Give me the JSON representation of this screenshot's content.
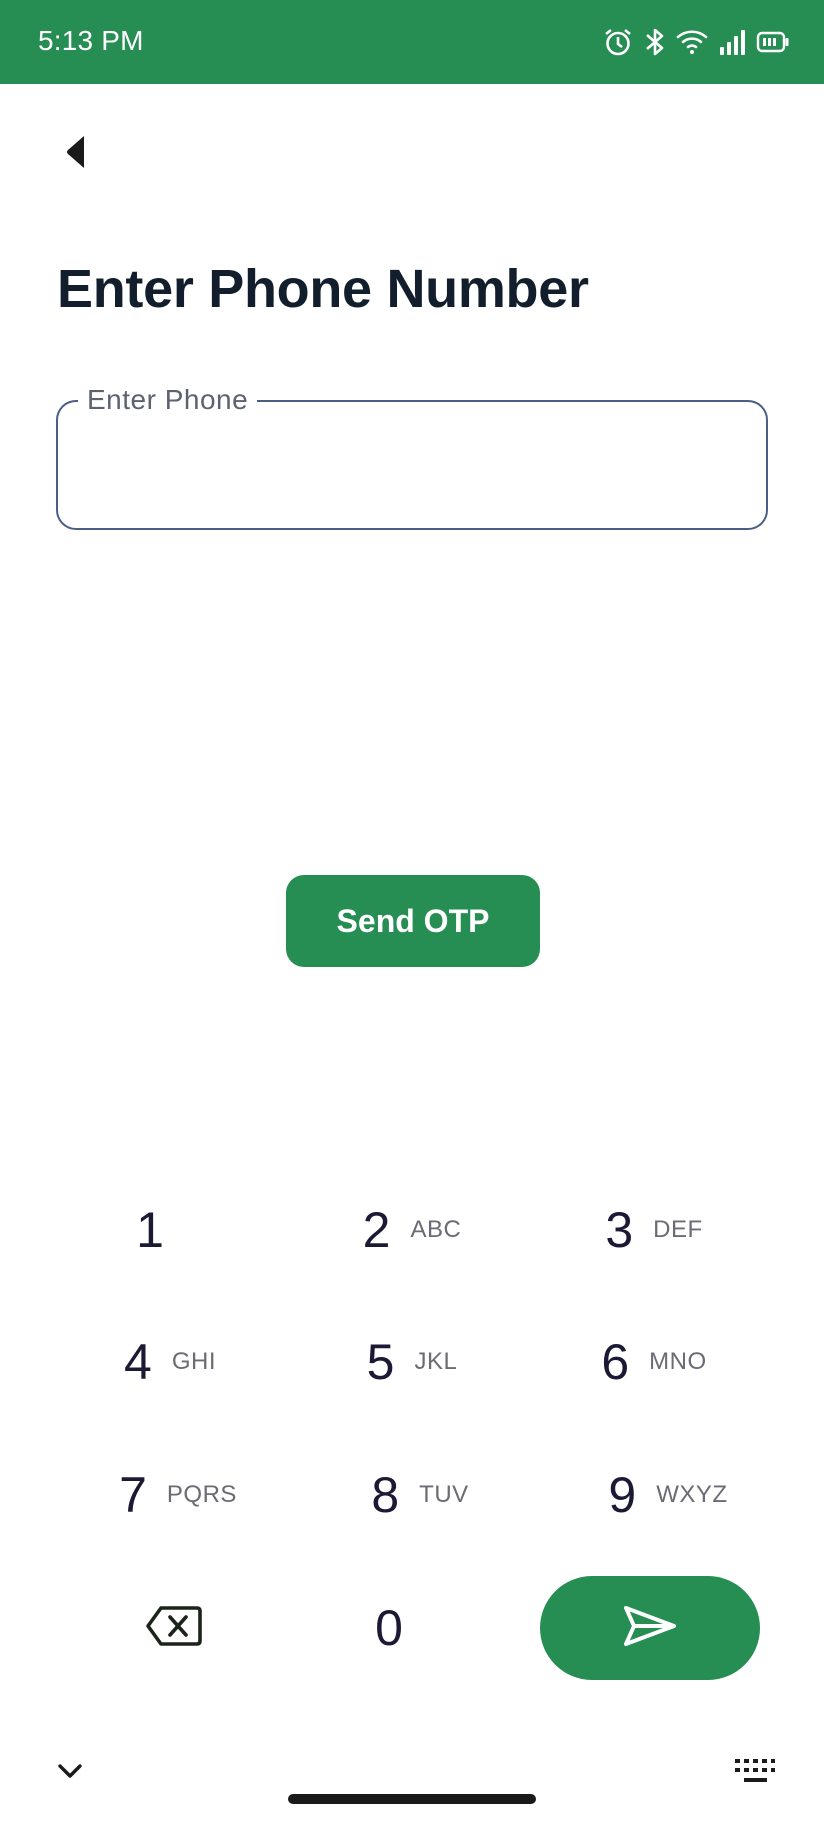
{
  "status_bar": {
    "time": "5:13 PM",
    "icons": [
      "alarm-icon",
      "bluetooth-icon",
      "wifi-icon",
      "signal-icon",
      "battery-icon"
    ]
  },
  "header": {
    "back_icon": "back-arrow-icon",
    "title": "Enter Phone Number"
  },
  "phone_field": {
    "label": "Enter Phone",
    "value": ""
  },
  "actions": {
    "send_otp_label": "Send OTP"
  },
  "keypad": {
    "keys": [
      {
        "digit": "1",
        "letters": ""
      },
      {
        "digit": "2",
        "letters": "ABC"
      },
      {
        "digit": "3",
        "letters": "DEF"
      },
      {
        "digit": "4",
        "letters": "GHI"
      },
      {
        "digit": "5",
        "letters": "JKL"
      },
      {
        "digit": "6",
        "letters": "MNO"
      },
      {
        "digit": "7",
        "letters": "PQRS"
      },
      {
        "digit": "8",
        "letters": "TUV"
      },
      {
        "digit": "9",
        "letters": "WXYZ"
      },
      {
        "digit": "0",
        "letters": ""
      }
    ],
    "backspace_icon": "backspace-icon",
    "send_icon": "send-icon",
    "accent_color": "#268d53"
  },
  "system_nav": {
    "collapse_icon": "chevron-down-icon",
    "keyboard_icon": "keyboard-icon"
  },
  "colors": {
    "primary": "#268d53",
    "title_text": "#131e2d",
    "field_border": "#4a5f83"
  }
}
